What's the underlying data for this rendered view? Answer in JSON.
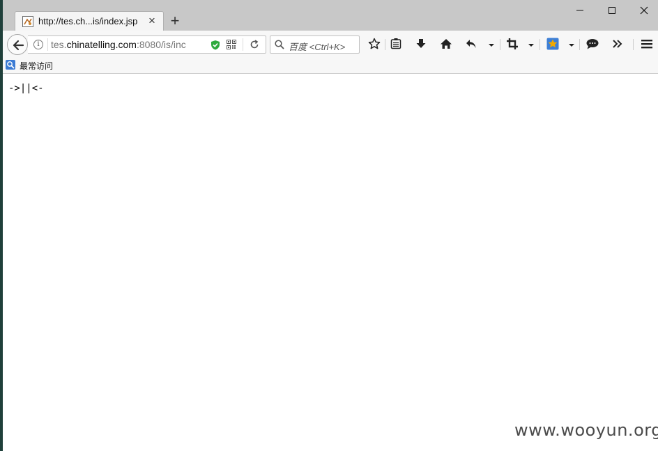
{
  "tab": {
    "title": "http://tes.ch...is/index.jsp",
    "close_label": "×",
    "new_tab_label": "+"
  },
  "window_controls": {
    "minimize": "minimize-icon",
    "maximize": "maximize-icon",
    "close": "close-icon"
  },
  "urlbar": {
    "prefix": "tes.",
    "host": "chinatelling.com",
    "suffix": ":8080/is/inc"
  },
  "search": {
    "placeholder": "百度 <Ctrl+K>"
  },
  "toolbar_icons": [
    "star-icon",
    "reader-icon",
    "download-icon",
    "home-icon",
    "undo-icon",
    "crop-icon",
    "extension-star-icon",
    "chat-icon",
    "overflow-icon",
    "menu-icon"
  ],
  "bookmarks": {
    "items": [
      {
        "label": "最常访问"
      }
    ]
  },
  "content": {
    "text": "->||<-"
  },
  "watermark": "www.wooyun.org",
  "colors": {
    "tabstrip": "#c8c8c8",
    "toolbar": "#f7f7f7",
    "shield": "#2eaa3d",
    "extension_star": "#f2a900"
  }
}
